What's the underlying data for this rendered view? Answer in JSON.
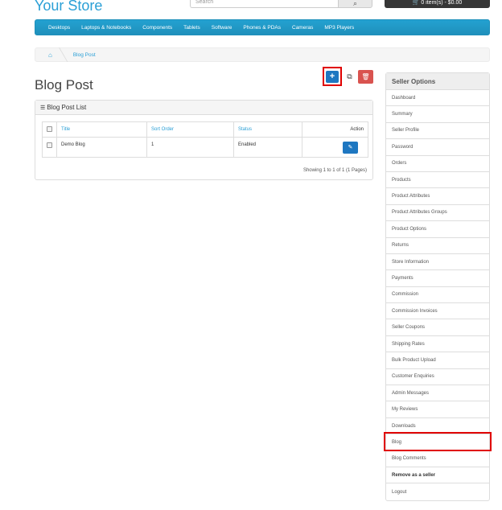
{
  "header": {
    "store_name": "Your Store",
    "search_placeholder": "Search",
    "search_icon": "magnifier-icon",
    "cart_text": "🛒 0 item(s) - $0.00"
  },
  "menu": [
    "Desktops",
    "Laptops & Notebooks",
    "Components",
    "Tablets",
    "Software",
    "Phones & PDAs",
    "Cameras",
    "MP3 Players"
  ],
  "breadcrumb": {
    "home_icon": "⌂",
    "current": "Blog Post"
  },
  "page": {
    "title": "Blog Post",
    "add_label": "+",
    "copy_label": "⧉",
    "delete_label": "🗑"
  },
  "panel": {
    "title": "Blog Post List",
    "columns": {
      "title": "Title",
      "sort_order": "Sort Order",
      "status": "Status",
      "action": "Action"
    },
    "rows": [
      {
        "title": "Demo Blog",
        "sort_order": "1",
        "status": "Enabled",
        "edit_label": "✎"
      }
    ],
    "showing": "Showing 1 to 1 of 1 (1 Pages)"
  },
  "sidebar": {
    "title": "Seller Options",
    "items": [
      "Dashboard",
      "Summary",
      "Seller Profile",
      "Password",
      "Orders",
      "Products",
      "Product Attributes",
      "Product Attributes Groups",
      "Product Options",
      "Returns",
      "Store Information",
      "Payments",
      "Commission",
      "Commission Invoices",
      "Seller Coupons",
      "Shipping Rates",
      "Bulk Product Upload",
      "Customer Enquiries",
      "Admin Messages",
      "My Reviews",
      "Downloads",
      "Blog",
      "Blog Comments",
      "Remove as a seller",
      "Logout"
    ]
  },
  "colors": {
    "accent": "#2a9fd6",
    "menu": "#229ac8",
    "primary_button": "#1e77c1",
    "danger": "#d9534f",
    "highlight": "#e00000"
  }
}
